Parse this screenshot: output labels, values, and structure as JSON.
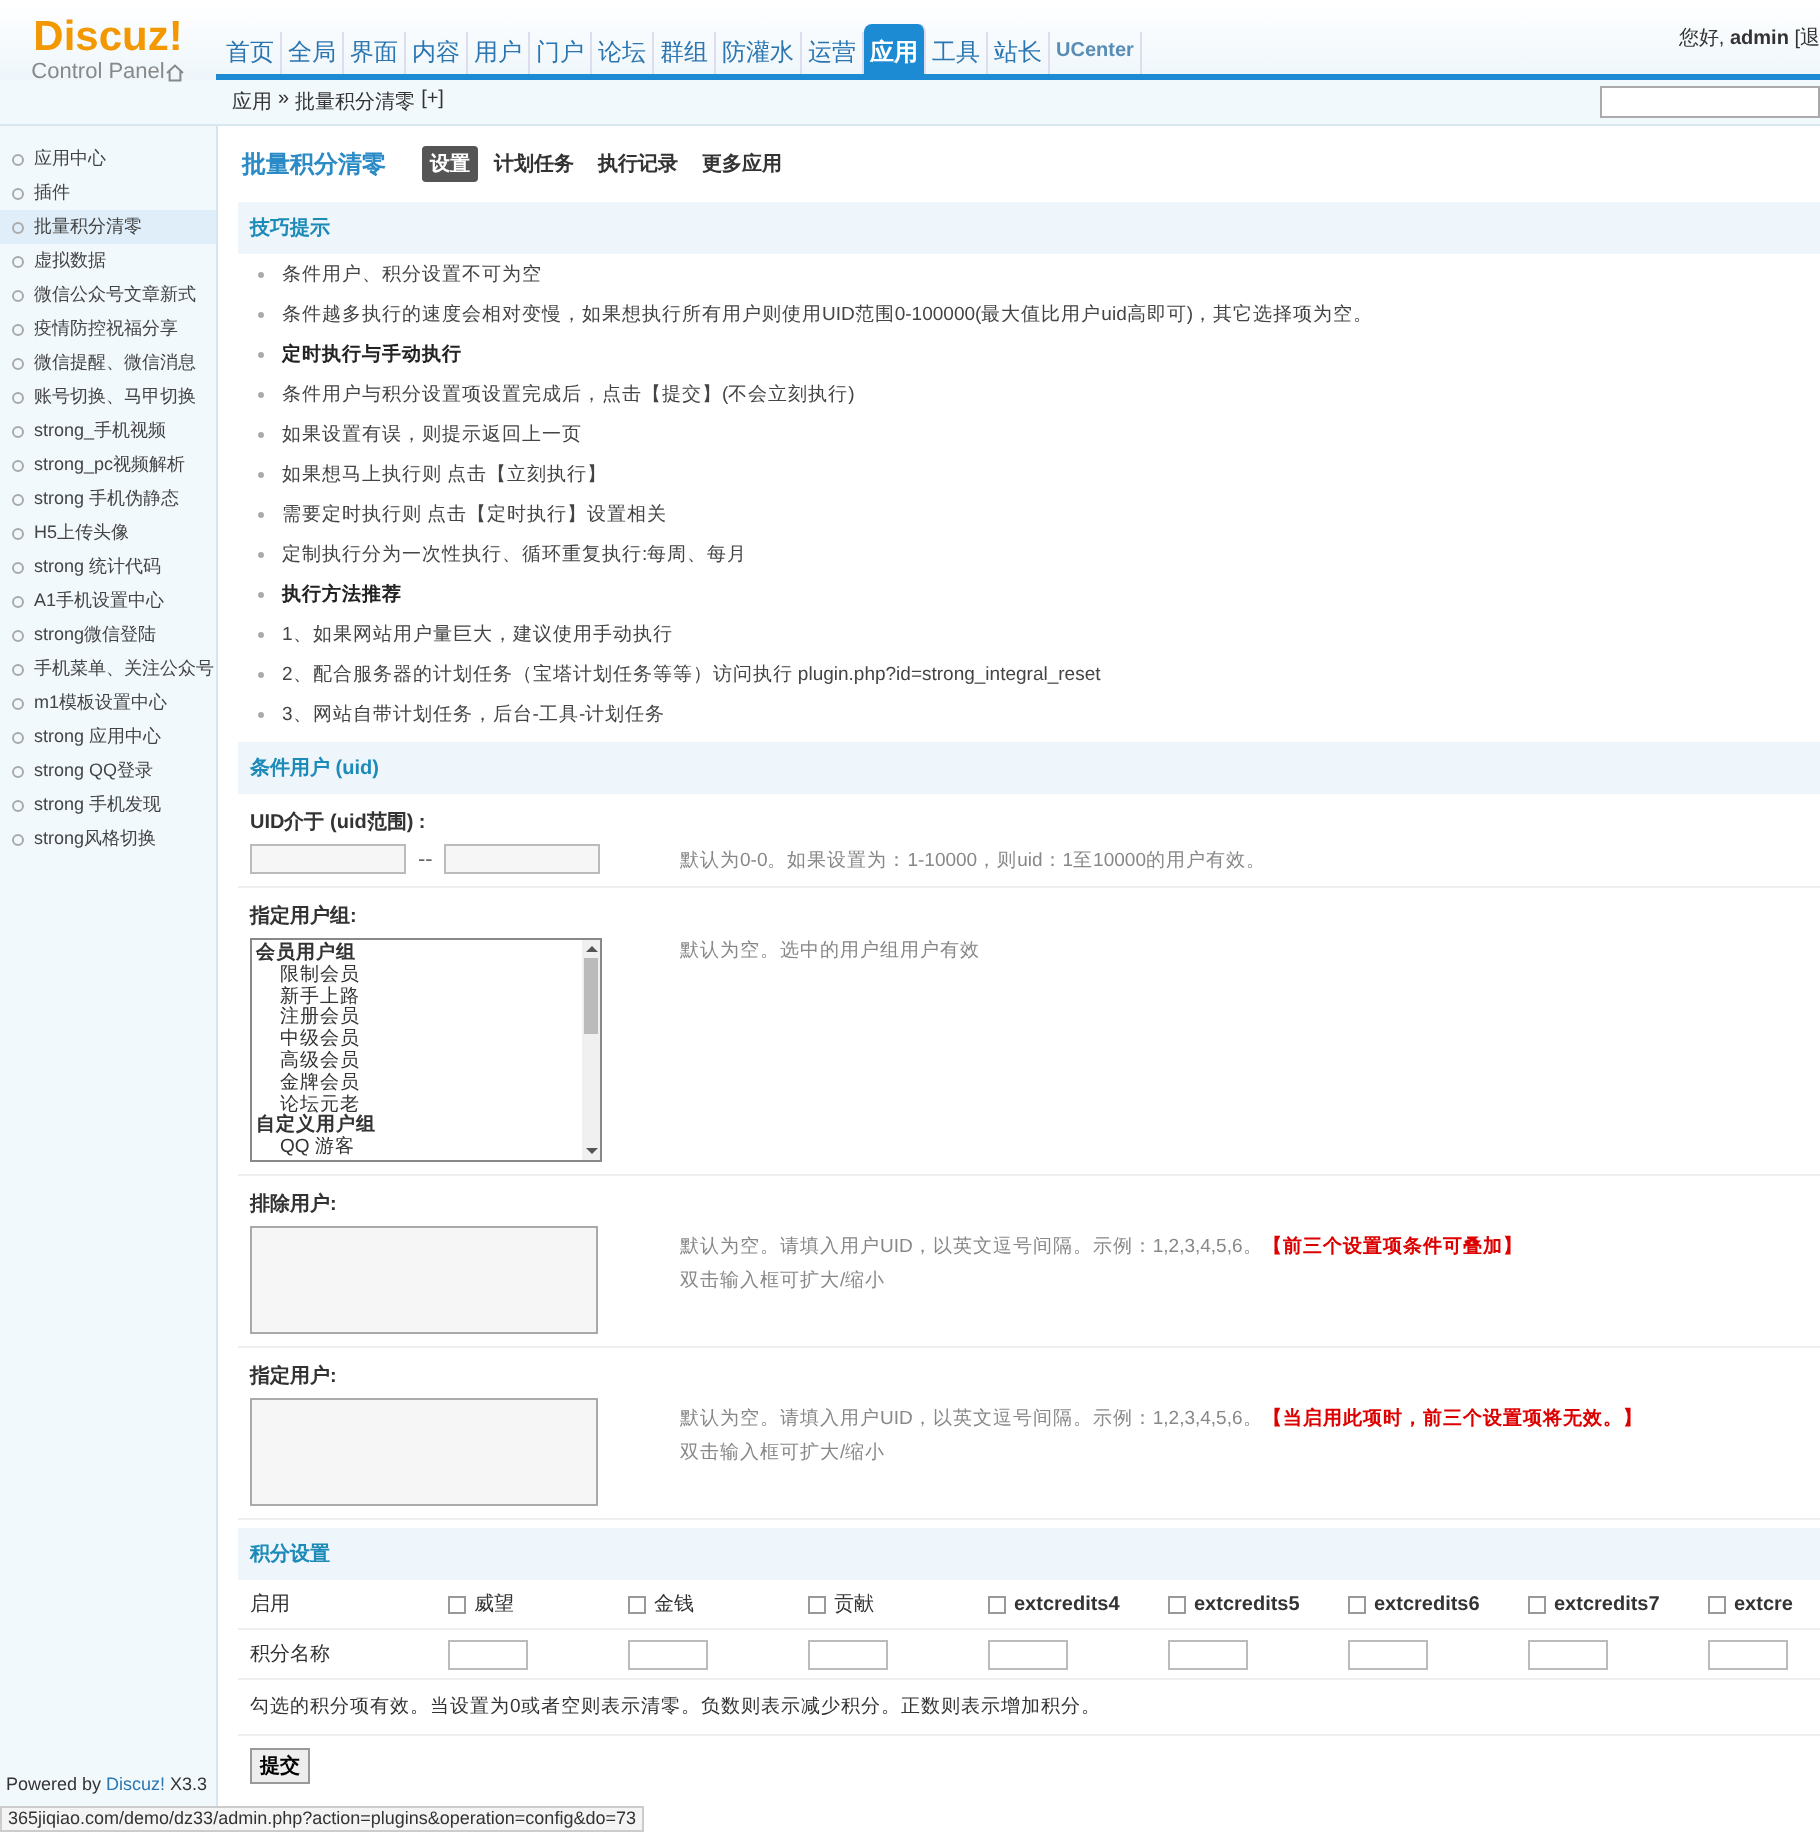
{
  "header": {
    "logo": "Discuz!",
    "logo_sub": "Control Panel",
    "greeting": "您好, ",
    "user": "admin",
    "logout": "[退",
    "nav": [
      {
        "label": "首页",
        "selected": false
      },
      {
        "label": "全局",
        "selected": false
      },
      {
        "label": "界面",
        "selected": false
      },
      {
        "label": "内容",
        "selected": false
      },
      {
        "label": "用户",
        "selected": false
      },
      {
        "label": "门户",
        "selected": false
      },
      {
        "label": "论坛",
        "selected": false
      },
      {
        "label": "群组",
        "selected": false
      },
      {
        "label": "防灌水",
        "selected": false
      },
      {
        "label": "运营",
        "selected": false
      },
      {
        "label": "应用",
        "selected": true
      },
      {
        "label": "工具",
        "selected": false
      },
      {
        "label": "站长",
        "selected": false
      },
      {
        "label": "UCenter",
        "selected": false
      }
    ]
  },
  "breadcrumb": {
    "items": [
      "应用",
      "批量积分清零"
    ],
    "separator": "»",
    "add": "[+]"
  },
  "sidebar": {
    "items": [
      {
        "label": "应用中心",
        "selected": false
      },
      {
        "label": "插件",
        "selected": false
      },
      {
        "label": "批量积分清零",
        "selected": true
      },
      {
        "label": "虚拟数据",
        "selected": false
      },
      {
        "label": "微信公众号文章新式",
        "selected": false
      },
      {
        "label": "疫情防控祝福分享",
        "selected": false
      },
      {
        "label": "微信提醒、微信消息",
        "selected": false
      },
      {
        "label": "账号切换、马甲切换",
        "selected": false
      },
      {
        "label": "strong_手机视频",
        "selected": false
      },
      {
        "label": "strong_pc视频解析",
        "selected": false
      },
      {
        "label": "strong 手机伪静态",
        "selected": false
      },
      {
        "label": "H5上传头像",
        "selected": false
      },
      {
        "label": "strong 统计代码",
        "selected": false
      },
      {
        "label": "A1手机设置中心",
        "selected": false
      },
      {
        "label": "strong微信登陆",
        "selected": false
      },
      {
        "label": "手机菜单、关注公众号",
        "selected": false
      },
      {
        "label": "m1模板设置中心",
        "selected": false
      },
      {
        "label": "strong 应用中心",
        "selected": false
      },
      {
        "label": "strong QQ登录",
        "selected": false
      },
      {
        "label": "strong 手机发现",
        "selected": false
      },
      {
        "label": "strong风格切换",
        "selected": false
      }
    ],
    "footer": "Powered by ",
    "footer_brand": "Discuz!",
    "footer_version": " X3.3"
  },
  "page": {
    "title": "批量积分清零",
    "tabs": [
      {
        "label": "设置",
        "selected": true
      },
      {
        "label": "计划任务",
        "selected": false
      },
      {
        "label": "执行记录",
        "selected": false
      },
      {
        "label": "更多应用",
        "selected": false
      }
    ]
  },
  "tips": {
    "title": "技巧提示",
    "items": [
      {
        "kind": "tip",
        "text": "条件用户、积分设置不可为空"
      },
      {
        "kind": "tip",
        "text": "条件越多执行的速度会相对变慢，如果想执行所有用户则使用UID范围0-100000(最大值比用户uid高即可)，其它选择项为空。"
      },
      {
        "kind": "heading",
        "text": "定时执行与手动执行"
      },
      {
        "kind": "tip",
        "text": "条件用户与积分设置项设置完成后，点击【提交】(不会立刻执行)"
      },
      {
        "kind": "tip",
        "text": "如果设置有误，则提示返回上一页"
      },
      {
        "kind": "tip",
        "text": "如果想马上执行则 点击【立刻执行】"
      },
      {
        "kind": "tip",
        "text": "需要定时执行则 点击【定时执行】设置相关"
      },
      {
        "kind": "tip",
        "text": "定制执行分为一次性执行、循环重复执行:每周、每月"
      },
      {
        "kind": "heading",
        "text": "执行方法推荐"
      },
      {
        "kind": "tip",
        "text": "1、如果网站用户量巨大，建议使用手动执行"
      },
      {
        "kind": "tip",
        "text": "2、配合服务器的计划任务（宝塔计划任务等等）访问执行 plugin.php?id=strong_integral_reset"
      },
      {
        "kind": "tip",
        "text": "3、网站自带计划任务，后台-工具-计划任务"
      }
    ]
  },
  "conditions": {
    "title": "条件用户 (uid)",
    "uid_label": "UID介于 (uid范围) :",
    "uid_separator": "--",
    "uid_hint": "默认为0-0。如果设置为：1-10000，则uid：1至10000的用户有效。",
    "group_label": "指定用户组:",
    "group_hint": "默认为空。选中的用户组用户有效",
    "groups": [
      {
        "label": "会员用户组",
        "children": [
          {
            "label": "限制会员"
          },
          {
            "label": "新手上路"
          },
          {
            "label": "注册会员"
          },
          {
            "label": "中级会员"
          },
          {
            "label": "高级会员"
          },
          {
            "label": "金牌会员"
          },
          {
            "label": "论坛元老"
          }
        ]
      },
      {
        "label": "自定义用户组",
        "children": [
          {
            "label": "QQ 游客"
          }
        ]
      }
    ],
    "user_fields": [
      {
        "label": "排除用户:",
        "hint": "默认为空。请填入用户UID，以英文逗号间隔。示例：1,2,3,4,5,6。",
        "note": "【前三个设置项条件可叠加】",
        "hint2": "双击输入框可扩大/缩小"
      },
      {
        "label": "指定用户:",
        "hint": "默认为空。请填入用户UID，以英文逗号间隔。示例：1,2,3,4,5,6。",
        "note": "【当启用此项时，前三个设置项将无效。】",
        "hint2": "双击输入框可扩大/缩小"
      }
    ]
  },
  "credits": {
    "title": "积分设置",
    "enable_label": "启用",
    "name_label": "积分名称",
    "items": [
      {
        "label": "威望",
        "checked": false,
        "bold": false
      },
      {
        "label": "金钱",
        "checked": false,
        "bold": false
      },
      {
        "label": "贡献",
        "checked": false,
        "bold": false
      },
      {
        "label": "extcredits4",
        "checked": false,
        "bold": true
      },
      {
        "label": "extcredits5",
        "checked": false,
        "bold": true
      },
      {
        "label": "extcredits6",
        "checked": false,
        "bold": true
      },
      {
        "label": "extcredits7",
        "checked": false,
        "bold": true
      },
      {
        "label": "extcre",
        "checked": false,
        "bold": true
      }
    ],
    "note": "勾选的积分项有效。当设置为0或者空则表示清零。负数则表示减少积分。正数则表示增加积分。",
    "submit": "提交"
  },
  "status_bar": "365jiqiao.com/demo/dz33/admin.php?action=plugins&operation=config&do=73"
}
